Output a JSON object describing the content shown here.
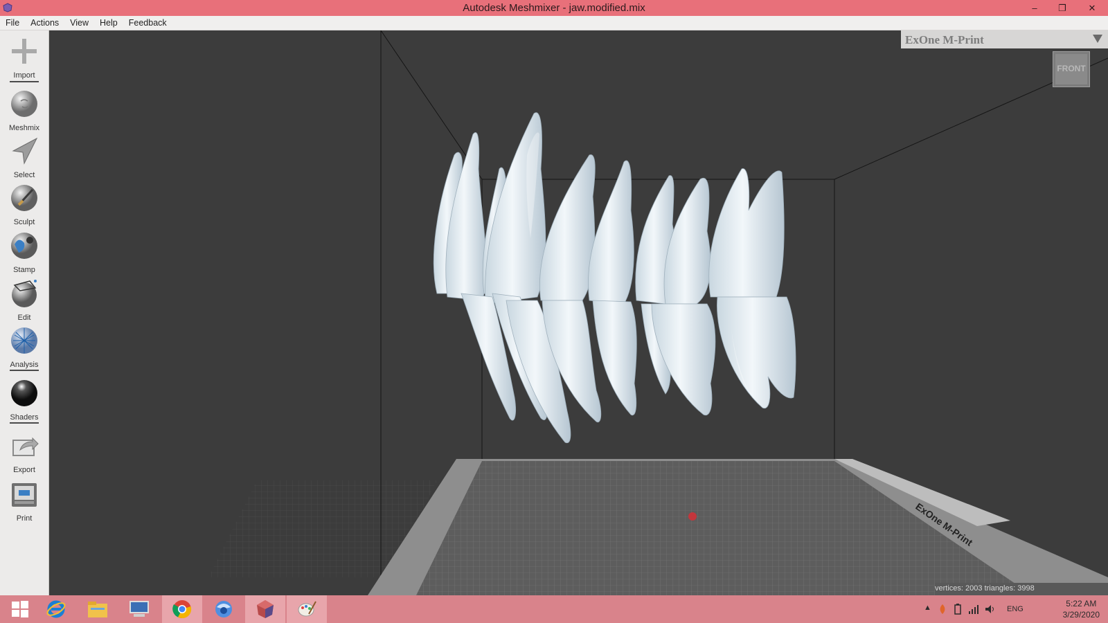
{
  "window": {
    "title": "Autodesk Meshmixer - jaw.modified.mix",
    "minimize": "–",
    "restore": "❐",
    "close": "✕"
  },
  "menu": [
    "File",
    "Actions",
    "View",
    "Help",
    "Feedback"
  ],
  "tools": [
    {
      "label": "Import",
      "icon": "plus-icon"
    },
    {
      "label": "Meshmix",
      "icon": "meshmix-icon"
    },
    {
      "label": "Select",
      "icon": "select-arrow-icon"
    },
    {
      "label": "Sculpt",
      "icon": "sculpt-brush-icon"
    },
    {
      "label": "Stamp",
      "icon": "stamp-icon"
    },
    {
      "label": "Edit",
      "icon": "edit-icon"
    },
    {
      "label": "Analysis",
      "icon": "analysis-icon"
    },
    {
      "label": "Shaders",
      "icon": "shaders-icon"
    },
    {
      "label": "Export",
      "icon": "export-icon"
    },
    {
      "label": "Print",
      "icon": "print-icon"
    }
  ],
  "viewport": {
    "printer": "ExOne M-Print",
    "platform_label": "ExOne M-Print",
    "viewcube_face": "FRONT",
    "stats": "vertices: 2003 triangles: 3998"
  },
  "taskbar": {
    "apps": [
      "start-icon",
      "internet-explorer-icon",
      "file-explorer-icon",
      "remote-desktop-icon",
      "chrome-icon",
      "browser-icon",
      "meshmixer-icon",
      "paint-icon"
    ],
    "language": "ENG",
    "time": "5:22 AM",
    "date": "3/29/2020"
  },
  "colors": {
    "titlebar": "#e8707a",
    "taskbar": "#d9838b",
    "viewport_bg": "#3c3c3c",
    "teeth": "#e3ecf1"
  }
}
